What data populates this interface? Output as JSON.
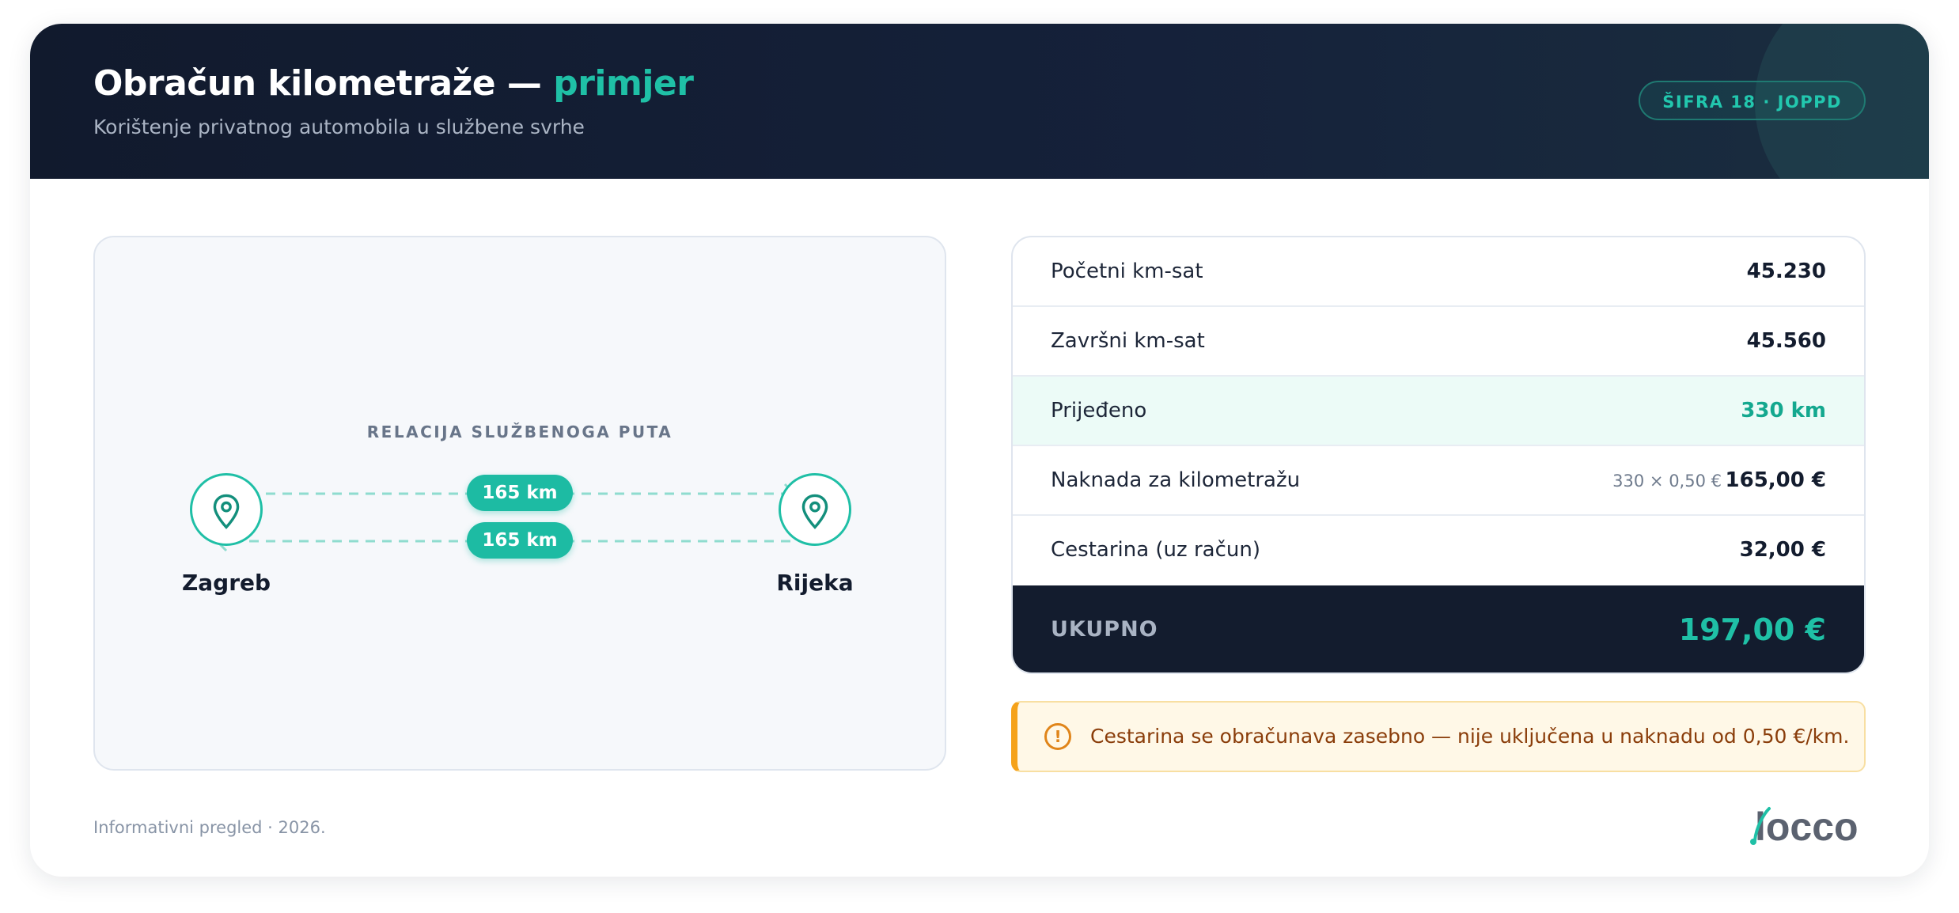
{
  "header": {
    "title_main": "Obračun kilometraže —",
    "title_accent": "primjer",
    "subtitle": "Korištenje privatnog automobila u službene svrhe",
    "badge": "ŠIFRA 18 · JOPPD"
  },
  "route": {
    "heading": "RELACIJA SLUŽBENOGA PUTA",
    "from_city": "Zagreb",
    "to_city": "Rijeka",
    "outbound_km": "165 km",
    "return_km": "165 km",
    "icons": [
      "map-pin-icon",
      "arrow-right-icon",
      "arrow-left-icon"
    ]
  },
  "table": {
    "rows": [
      {
        "label": "Početni km-sat",
        "value": "45.230"
      },
      {
        "label": "Završni km-sat",
        "value": "45.560"
      },
      {
        "label": "Prijeđeno",
        "value": "330 km"
      },
      {
        "label": "Naknada za kilometražu",
        "note": "330 × 0,50 €",
        "value": "165,00 €"
      },
      {
        "label": "Cestarina (uz račun)",
        "value": "32,00 €"
      }
    ],
    "total_label": "UKUPNO",
    "total_value": "197,00 €"
  },
  "warning": {
    "icon": "alert-circle-icon",
    "symbol": "!",
    "text": "Cestarina se obračunava zasebno — nije uključena u naknadu od 0,50 €/km."
  },
  "footer": {
    "note": "Informativni pregled · 2026.",
    "logo_text": "locco"
  },
  "colors": {
    "accent": "#1fc0a6",
    "dark": "#131c2e",
    "warning": "#f5a21a"
  }
}
